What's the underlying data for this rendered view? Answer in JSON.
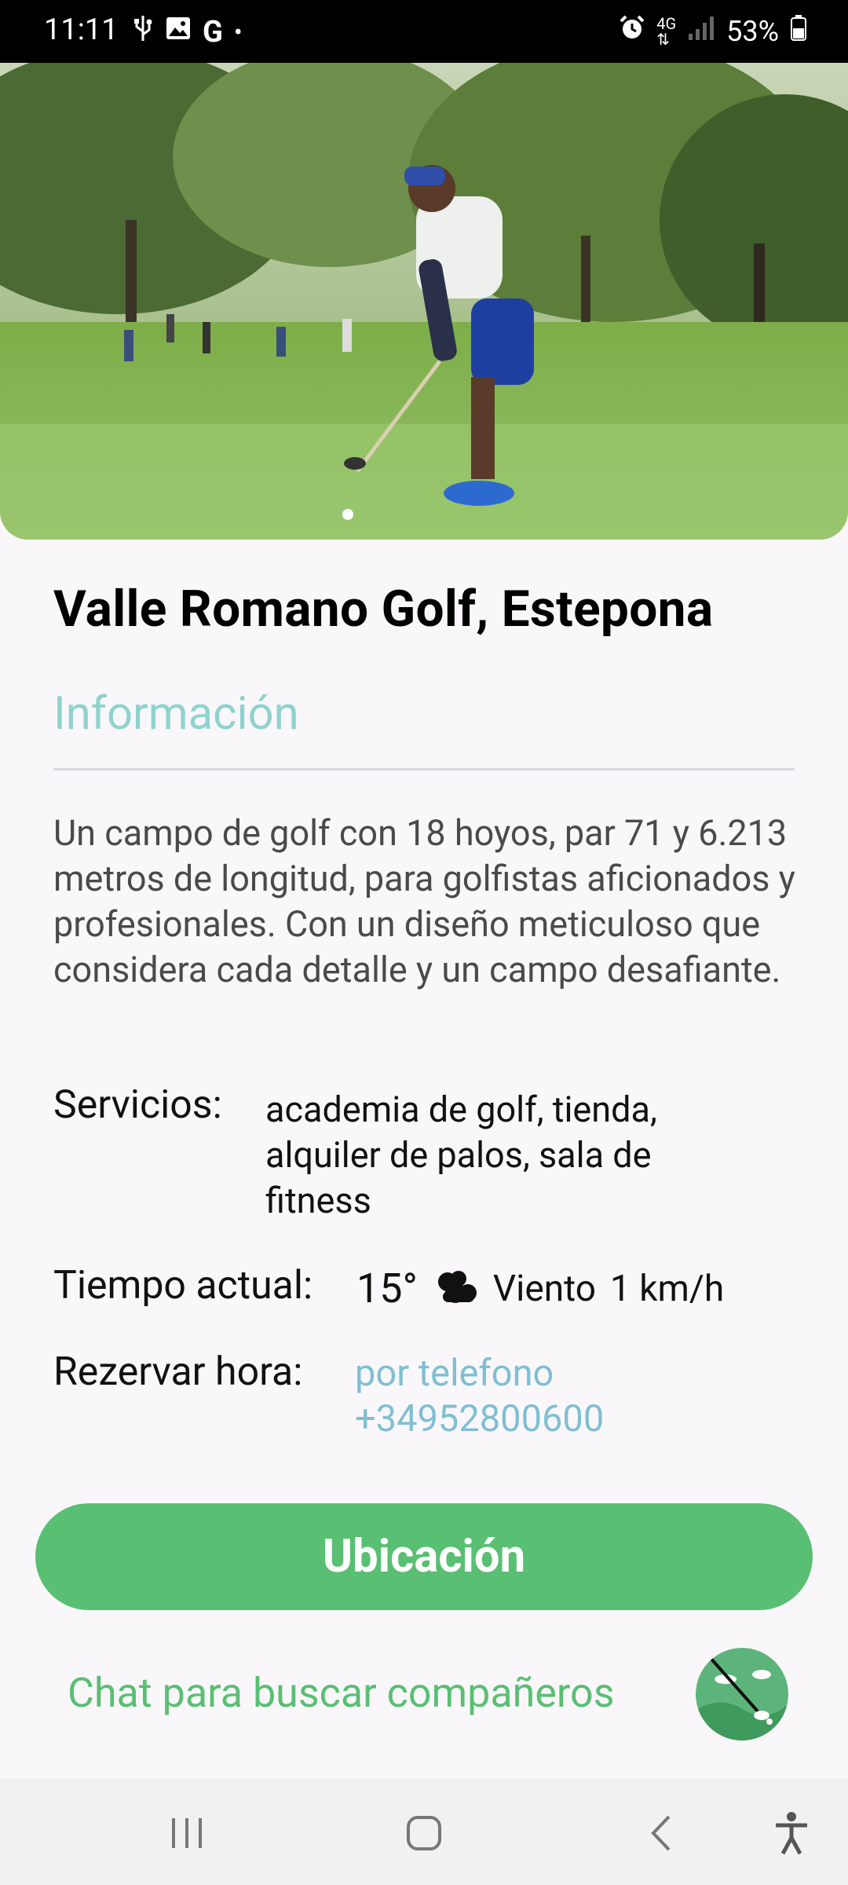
{
  "status_bar": {
    "time": "11:11",
    "battery": "53%",
    "left_icons": [
      "usb-icon",
      "image-icon",
      "google-icon",
      "dot-icon"
    ],
    "right_icons": [
      "alarm-icon",
      "4g-icon",
      "signal-icon",
      "battery-icon"
    ]
  },
  "course": {
    "title": "Valle Romano Golf, Estepona",
    "section_header": "Información",
    "description": "Un campo de golf con 18 hoyos, par 71 y 6.213 metros de longitud, para golfistas aficionados y profesionales. Con un diseño meticuloso que considera cada detalle y un campo desafiante."
  },
  "services": {
    "label": "Servicios:",
    "value": "academia de golf, tienda, alquiler de palos, sala de fitness"
  },
  "weather": {
    "label": "Tiempo actual:",
    "temperature": "15°",
    "icon": "cloudy-icon",
    "wind_label": "Viento",
    "wind_value": "1 km/h"
  },
  "booking": {
    "label": "Rezervar hora:",
    "phone_line1": "por telefono",
    "phone_line2": "+34952800600"
  },
  "actions": {
    "location_button": "Ubicación",
    "chat_link": "Chat para buscar compañeros"
  },
  "colors": {
    "accent_green": "#59bf72",
    "header_teal": "#8fd3cd",
    "link_blue": "#7fbfd3"
  }
}
